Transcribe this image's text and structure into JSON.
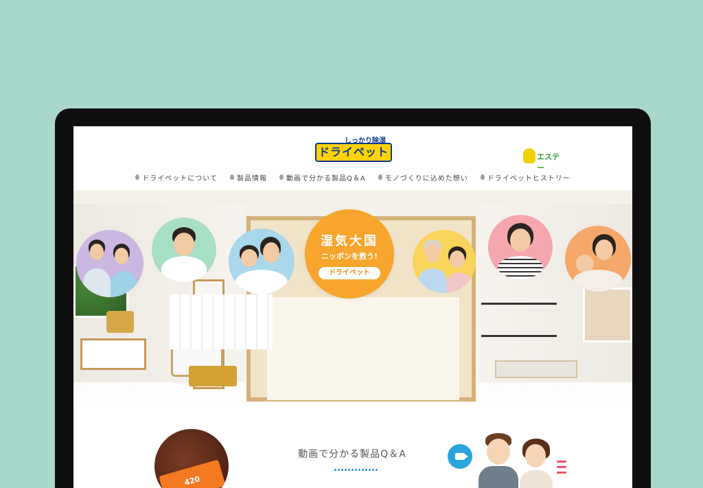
{
  "header": {
    "tagline": "しっかり除湿",
    "logo_text": "ドライペット",
    "partner_name": "エステー"
  },
  "nav": {
    "items": [
      {
        "label": "ドライペットについて"
      },
      {
        "label": "製品情報"
      },
      {
        "label": "動画で分かる製品Q＆A"
      },
      {
        "label": "モノづくりに込めた想い"
      },
      {
        "label": "ドライペットヒストリー"
      }
    ]
  },
  "hero": {
    "title": "湿気大国",
    "subtitle": "ニッポンを救う!",
    "button_label": "ドライペット",
    "bubble_color": "#f7a52c"
  },
  "section": {
    "title": "動画で分かる製品Q＆A",
    "product_label": "420"
  },
  "colors": {
    "background": "#a8d8cc",
    "frame": "#0f0f0f",
    "accent_blue": "#2aa4dc",
    "accent_orange": "#f7a52c"
  }
}
